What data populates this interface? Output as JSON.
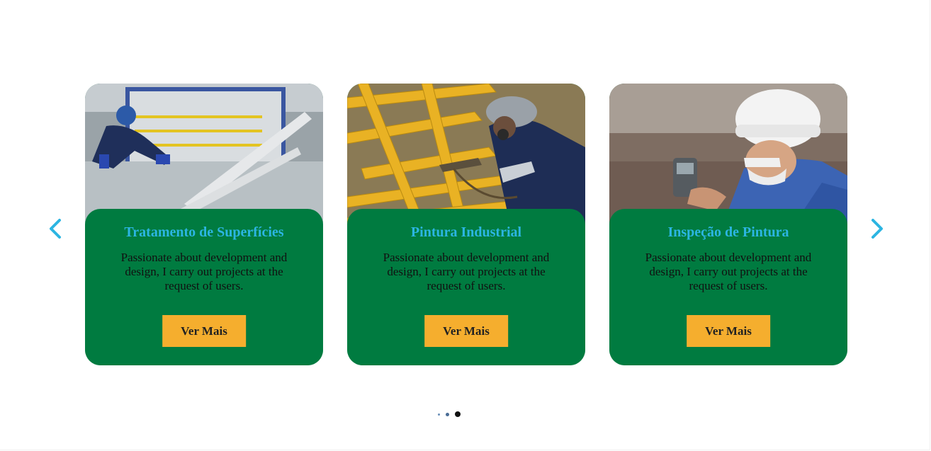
{
  "carousel": {
    "prev_icon": "chevron-left-icon",
    "next_icon": "chevron-right-icon",
    "arrow_color": "#2cb5e2",
    "cards": [
      {
        "title": "Tratamento de Superfícies",
        "description": "Passionate about development and design, I carry out projects at the request of users.",
        "button_label": "Ver Mais",
        "photo": "worker-surface-treatment-photo"
      },
      {
        "title": "Pintura Industrial",
        "description": "Passionate about development and design, I carry out projects at the request of users.",
        "button_label": "Ver Mais",
        "photo": "worker-spray-painting-photo"
      },
      {
        "title": "Inspeção de Pintura",
        "description": "Passionate about development and design, I carry out projects at the request of users.",
        "button_label": "Ver Mais",
        "photo": "worker-paint-inspection-photo"
      }
    ],
    "pagination": {
      "count": 3,
      "active_index": 2
    }
  },
  "colors": {
    "card_bg": "#007b40",
    "title": "#2cb5e2",
    "button": "#f5ae2e"
  }
}
